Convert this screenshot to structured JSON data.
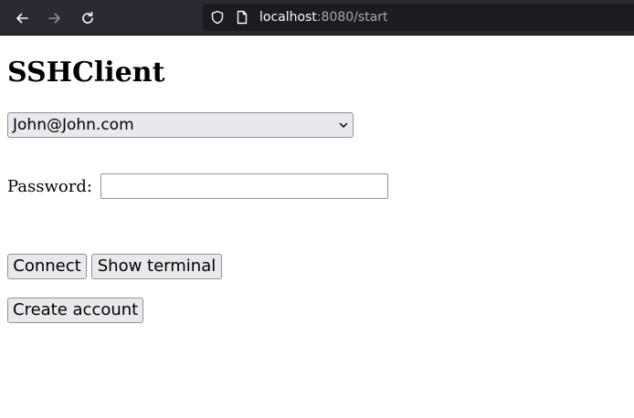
{
  "browser": {
    "url_host": "localhost",
    "url_rest": ":8080/start",
    "icons": {
      "back": "arrow-left-icon",
      "forward": "arrow-right-icon",
      "reload": "reload-icon",
      "shield": "shield-icon",
      "page": "page-icon"
    }
  },
  "page": {
    "title": "SSHClient",
    "account_select": {
      "selected": "John@John.com"
    },
    "password": {
      "label": "Password:",
      "value": ""
    },
    "buttons": {
      "connect": "Connect",
      "show_terminal": "Show terminal",
      "create_account": "Create account"
    }
  },
  "colors": {
    "toolbar_bg": "#2b2a33",
    "url_bar_bg": "#1c1b22",
    "button_bg": "#e9e9ed",
    "control_border": "#8f8f9d"
  }
}
